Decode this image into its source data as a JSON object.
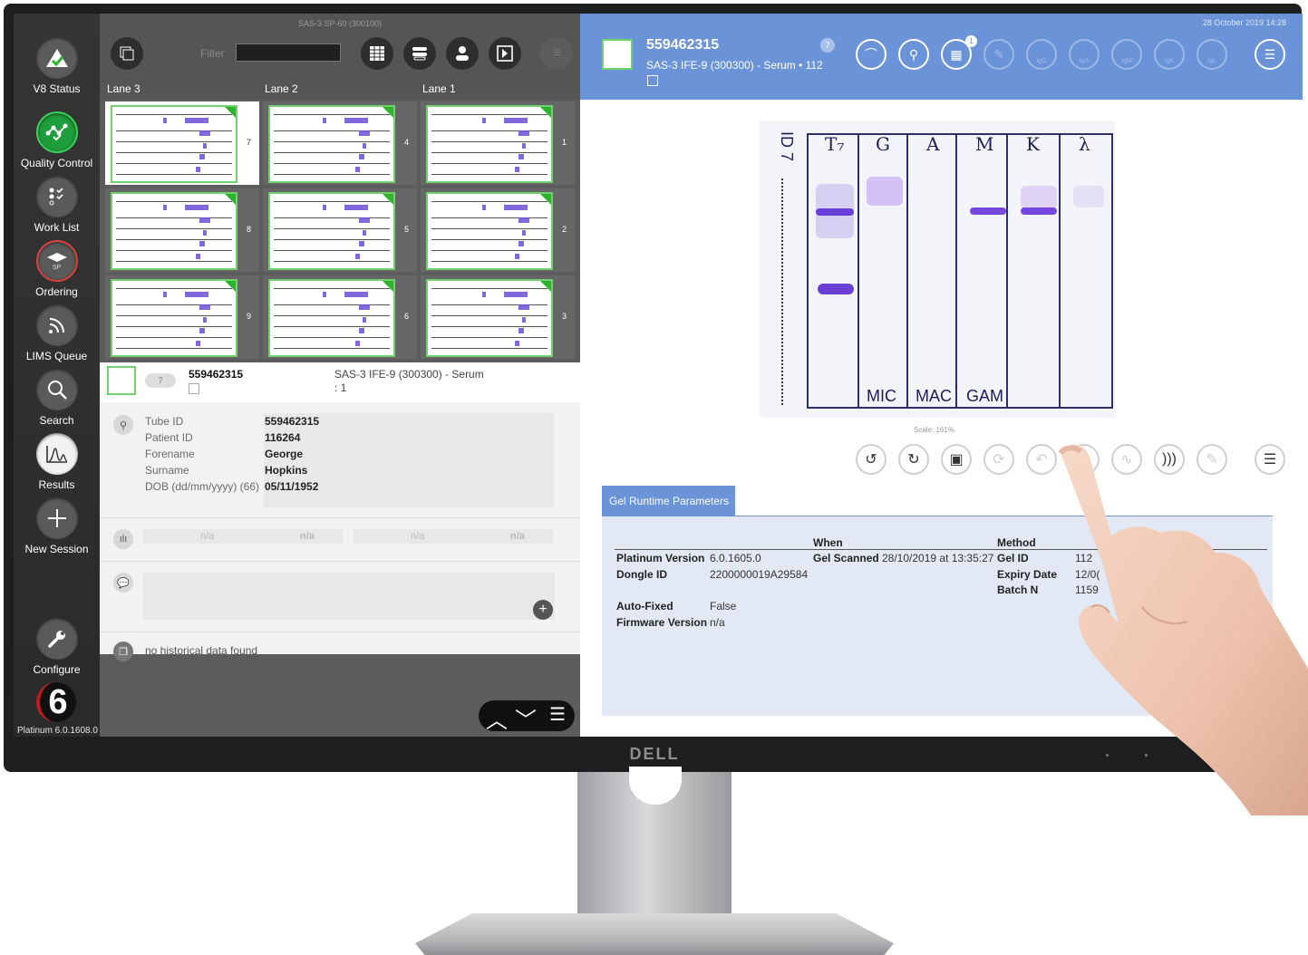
{
  "sidebar": {
    "items": [
      {
        "label": "V8 Status",
        "icon": "triangle-check-icon"
      },
      {
        "label": "Quality Control",
        "icon": "qc-graph-icon"
      },
      {
        "label": "Work List",
        "icon": "checklist-icon"
      },
      {
        "label": "Ordering",
        "icon": "sp-layers-icon",
        "badge": "SP"
      },
      {
        "label": "LIMS Queue",
        "icon": "wifi-stream-icon"
      },
      {
        "label": "Search",
        "icon": "search-icon"
      },
      {
        "label": "Results",
        "icon": "results-graph-icon"
      },
      {
        "label": "New Session",
        "icon": "plus-icon"
      },
      {
        "label": "Configure",
        "icon": "wrench-icon"
      }
    ],
    "logo": "6",
    "version": "Platinum 6.0.1608.0"
  },
  "mid": {
    "title": "SAS-3 SP-60 (300100)",
    "filter_label": "Filter",
    "filter_value": "",
    "lanes": [
      "Lane 3",
      "Lane 2",
      "Lane 1"
    ],
    "grid": [
      [
        "7",
        "4",
        "1"
      ],
      [
        "8",
        "5",
        "2"
      ],
      [
        "9",
        "6",
        "3"
      ]
    ],
    "selected": {
      "badge": "7",
      "id": "559462315",
      "test": "SAS-3 IFE-9 (300300) - Serum",
      "test_sub": ": 1"
    },
    "patient": [
      {
        "label": "Tube ID",
        "value": "559462315"
      },
      {
        "label": "Patient ID",
        "value": "116264"
      },
      {
        "label": "Forename",
        "value": "George"
      },
      {
        "label": "Surname",
        "value": "Hopkins"
      },
      {
        "label": "DOB (dd/mm/yyyy) (66)",
        "value": "05/11/1952"
      }
    ],
    "na_values": [
      "n/a",
      "n/a",
      "n/a",
      "n/a"
    ],
    "history": "no historical data found"
  },
  "right": {
    "datetime": "28 October 2019 14:28",
    "sample_id": "559462315",
    "sample_desc": "SAS-3 IFE-9 (300300) - Serum • 112",
    "badge": "7",
    "tool_badge": "1",
    "ig_labels": [
      "IgG",
      "IgA",
      "IgM",
      "IgK",
      "IgL"
    ],
    "scale": "Scale: 161%",
    "gel": {
      "side_label": "ID 7",
      "heads": [
        "T₇",
        "G",
        "A",
        "M",
        "K",
        "λ"
      ],
      "feet": [
        "MIC",
        "MAC",
        "GAM"
      ]
    },
    "params_tab": "Gel Runtime Parameters",
    "params_head": {
      "when": "When",
      "method": "Method"
    },
    "params": {
      "platinum_version_label": "Platinum Version",
      "platinum_version": "6.0.1605.0",
      "dongle_label": "Dongle ID",
      "dongle": "2200000019A29584",
      "autofixed_label": "Auto-Fixed",
      "autofixed": "False",
      "firmware_label": "Firmware Version",
      "firmware": "n/a",
      "gel_scanned_label": "Gel Scanned",
      "gel_scanned": "28/10/2019 at 13:35:27",
      "gel_id_label": "Gel ID",
      "gel_id": "112",
      "expiry_label": "Expiry Date",
      "expiry": "12/0(",
      "batch_label": "Batch N",
      "batch": "1159"
    }
  },
  "monitor": {
    "brand": "DELL"
  },
  "colors": {
    "header_blue": "#6b93d8",
    "qc_green": "#2cb52c",
    "band_purple": "#6a4fd6"
  }
}
